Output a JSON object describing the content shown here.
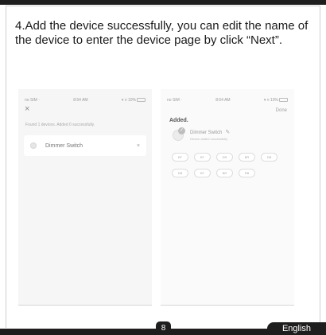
{
  "instruction": "4.Add the device successfully, you can edit the name of the device to enter the device page by click “Next”.",
  "left_phone": {
    "status_left": "no SIM ·",
    "status_time": "8:54 AM",
    "status_right": "▾ ¤ 10%",
    "close_glyph": "×",
    "found_text": "Found 1 devices. Added 0 successfully.",
    "device_name": "Dimmer Switch",
    "remove_glyph": "×"
  },
  "right_phone": {
    "status_left": "no SIM ·",
    "status_time": "8:54 AM",
    "status_right": "▾ ¤ 10%",
    "done_label": "Done",
    "added_title": "Added.",
    "device_name": "Dimmer Switch",
    "added_sub": "Device added successfully",
    "rooms": [
      "BT",
      "BT",
      "DR",
      "BR",
      "DB",
      "DB",
      "BT",
      "BR",
      "RB"
    ]
  },
  "page_number": "8",
  "language": "English",
  "icons": {
    "check": "check-icon",
    "edit": "pencil-icon",
    "device": "device-bulb-icon"
  }
}
